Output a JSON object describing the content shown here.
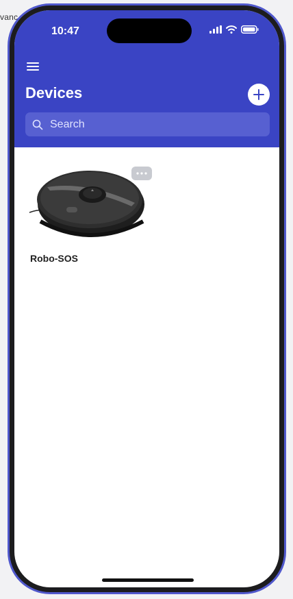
{
  "background_text": "vanc",
  "status_bar": {
    "time": "10:47"
  },
  "header": {
    "title": "Devices"
  },
  "search": {
    "placeholder": "Search"
  },
  "devices": [
    {
      "name": "Robo-SOS"
    }
  ],
  "colors": {
    "header_bg": "#3a44c4",
    "search_bg": "#5760d1",
    "frame": "#5058cc"
  },
  "icons": {
    "menu": "hamburger-menu-icon",
    "add": "plus-icon",
    "search": "search-icon",
    "more": "ellipsis-icon",
    "signal": "cellular-signal-icon",
    "wifi": "wifi-icon",
    "battery": "battery-icon"
  }
}
